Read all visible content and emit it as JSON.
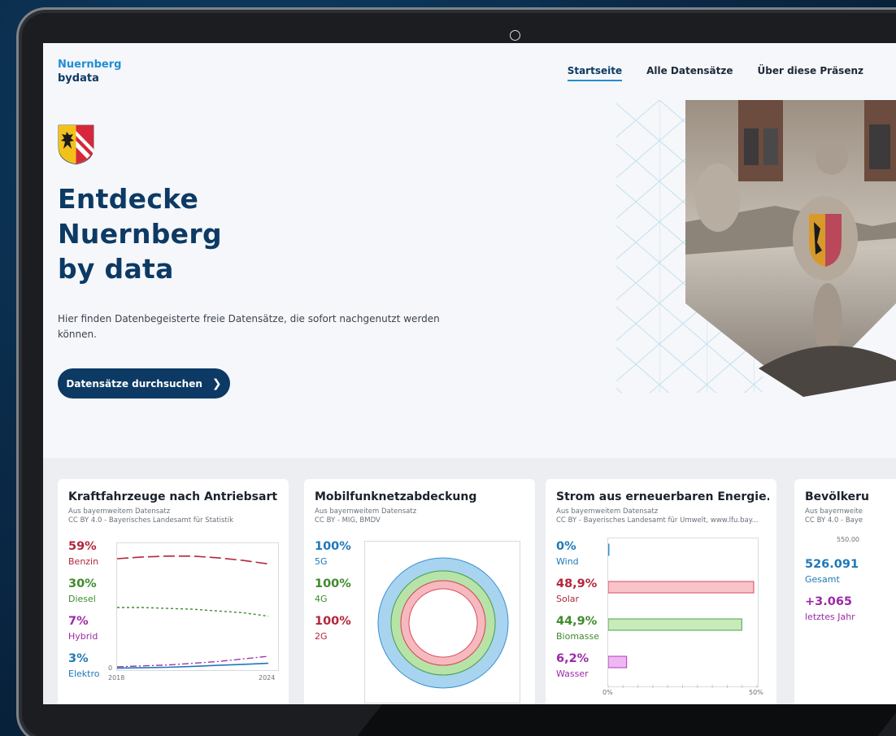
{
  "header": {
    "logo_line1": "Nuernberg",
    "logo_line2": "bydata",
    "nav": [
      {
        "label": "Startseite",
        "active": true
      },
      {
        "label": "Alle Datensätze",
        "active": false
      },
      {
        "label": "Über diese Präsenz",
        "active": false
      }
    ]
  },
  "hero": {
    "title_lines": [
      "Entdecke",
      "Nuernberg",
      "by data"
    ],
    "description": "Hier finden Datenbegeisterte freie Datensätze, die sofort nachgenutzt werden können.",
    "cta_label": "Datensätze durchsuchen",
    "cta_icon": "chevron-right-icon"
  },
  "cards": [
    {
      "title": "Kraftfahrzeuge nach Antriebsart",
      "source1": "Aus bayernweitem Datensatz",
      "source2": "CC BY 4.0 - Bayerisches Landesamt für Statistik",
      "stats": [
        {
          "value": "59%",
          "label": "Benzin",
          "color": "#b3263a"
        },
        {
          "value": "30%",
          "label": "Diesel",
          "color": "#3f8a2c"
        },
        {
          "value": "7%",
          "label": "Hybrid",
          "color": "#9c2aa6"
        },
        {
          "value": "3%",
          "label": "Elektro",
          "color": "#1f78b8"
        }
      ],
      "x_start": "2018",
      "x_end": "2024",
      "y_zero": "0"
    },
    {
      "title": "Mobilfunknetzabdeckung",
      "source1": "Aus bayernweitem Datensatz",
      "source2": "CC BY - MIG, BMDV",
      "stats": [
        {
          "value": "100%",
          "label": "5G",
          "color": "#1f78b8"
        },
        {
          "value": "100%",
          "label": "4G",
          "color": "#3f8a2c"
        },
        {
          "value": "100%",
          "label": "2G",
          "color": "#b3263a"
        }
      ]
    },
    {
      "title": "Strom aus erneuerbaren Energie...",
      "source1": "Aus bayernweitem Datensatz",
      "source2": "CC BY - Bayerisches Landesamt für Umwelt, www.lfu.bay...",
      "stats": [
        {
          "value": "0%",
          "label": "Wind",
          "color": "#1f78b8"
        },
        {
          "value": "48,9%",
          "label": "Solar",
          "color": "#b3263a"
        },
        {
          "value": "44,9%",
          "label": "Biomasse",
          "color": "#3f8a2c"
        },
        {
          "value": "6,2%",
          "label": "Wasser",
          "color": "#9c2aa6"
        }
      ],
      "x_start": "0%",
      "x_end": "50%"
    },
    {
      "title": "Bevölkeru",
      "source1": "Aus bayernweite",
      "source2": "CC BY 4.0 - Baye",
      "axis_top": "550.00",
      "stats": [
        {
          "value": "526.091",
          "label": "Gesamt",
          "color": "#1f78b8"
        },
        {
          "value": "+3.065",
          "label": "letztes Jahr",
          "color": "#9c2aa6"
        }
      ]
    }
  ],
  "chart_data": [
    {
      "type": "line",
      "x": [
        2018,
        2019,
        2020,
        2021,
        2022,
        2023,
        2024
      ],
      "xlim": [
        2018,
        2024
      ],
      "ylim": [
        0,
        70
      ],
      "series": [
        {
          "name": "Benzin",
          "values": [
            63,
            64,
            64.5,
            64.5,
            63.5,
            62,
            60
          ]
        },
        {
          "name": "Diesel",
          "values": [
            35,
            35,
            34.5,
            34,
            33,
            32,
            30
          ]
        },
        {
          "name": "Hybrid",
          "values": [
            1,
            1.5,
            2,
            3,
            4,
            5.5,
            7
          ]
        },
        {
          "name": "Elektro",
          "values": [
            0.2,
            0.4,
            0.7,
            1.2,
            1.8,
            2.4,
            3
          ]
        }
      ]
    },
    {
      "type": "pie",
      "series": [
        {
          "name": "5G",
          "values": [
            100
          ]
        },
        {
          "name": "4G",
          "values": [
            100
          ]
        },
        {
          "name": "2G",
          "values": [
            100
          ]
        }
      ]
    },
    {
      "type": "bar",
      "categories": [
        "Wind",
        "Solar",
        "Biomasse",
        "Wasser"
      ],
      "values": [
        0,
        48.9,
        44.9,
        6.2
      ],
      "xlim": [
        0,
        50
      ]
    }
  ]
}
